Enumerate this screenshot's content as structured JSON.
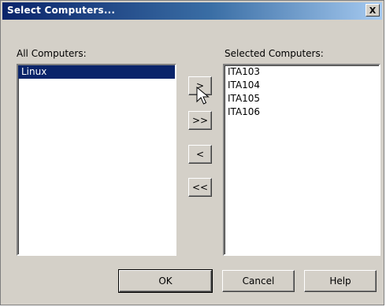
{
  "window": {
    "title": "Select Computers...",
    "close_glyph": "X"
  },
  "all_computers": {
    "label": "All Computers:",
    "items": [
      "Linux"
    ],
    "selected_index": 0
  },
  "selected_computers": {
    "label": "Selected Computers:",
    "items": [
      "ITA103",
      "ITA104",
      "ITA105",
      "ITA106"
    ]
  },
  "transfer_buttons": {
    "add": ">",
    "add_all": ">>",
    "remove": "<",
    "remove_all": "<<"
  },
  "footer": {
    "ok": "OK",
    "cancel": "Cancel",
    "help": "Help"
  },
  "colors": {
    "selection": "#0a246a",
    "dialog_face": "#d4d0c8",
    "title_start": "#0a246a",
    "title_end": "#a6caf0"
  },
  "icons": [
    "close-icon",
    "arrow-cursor-icon"
  ]
}
